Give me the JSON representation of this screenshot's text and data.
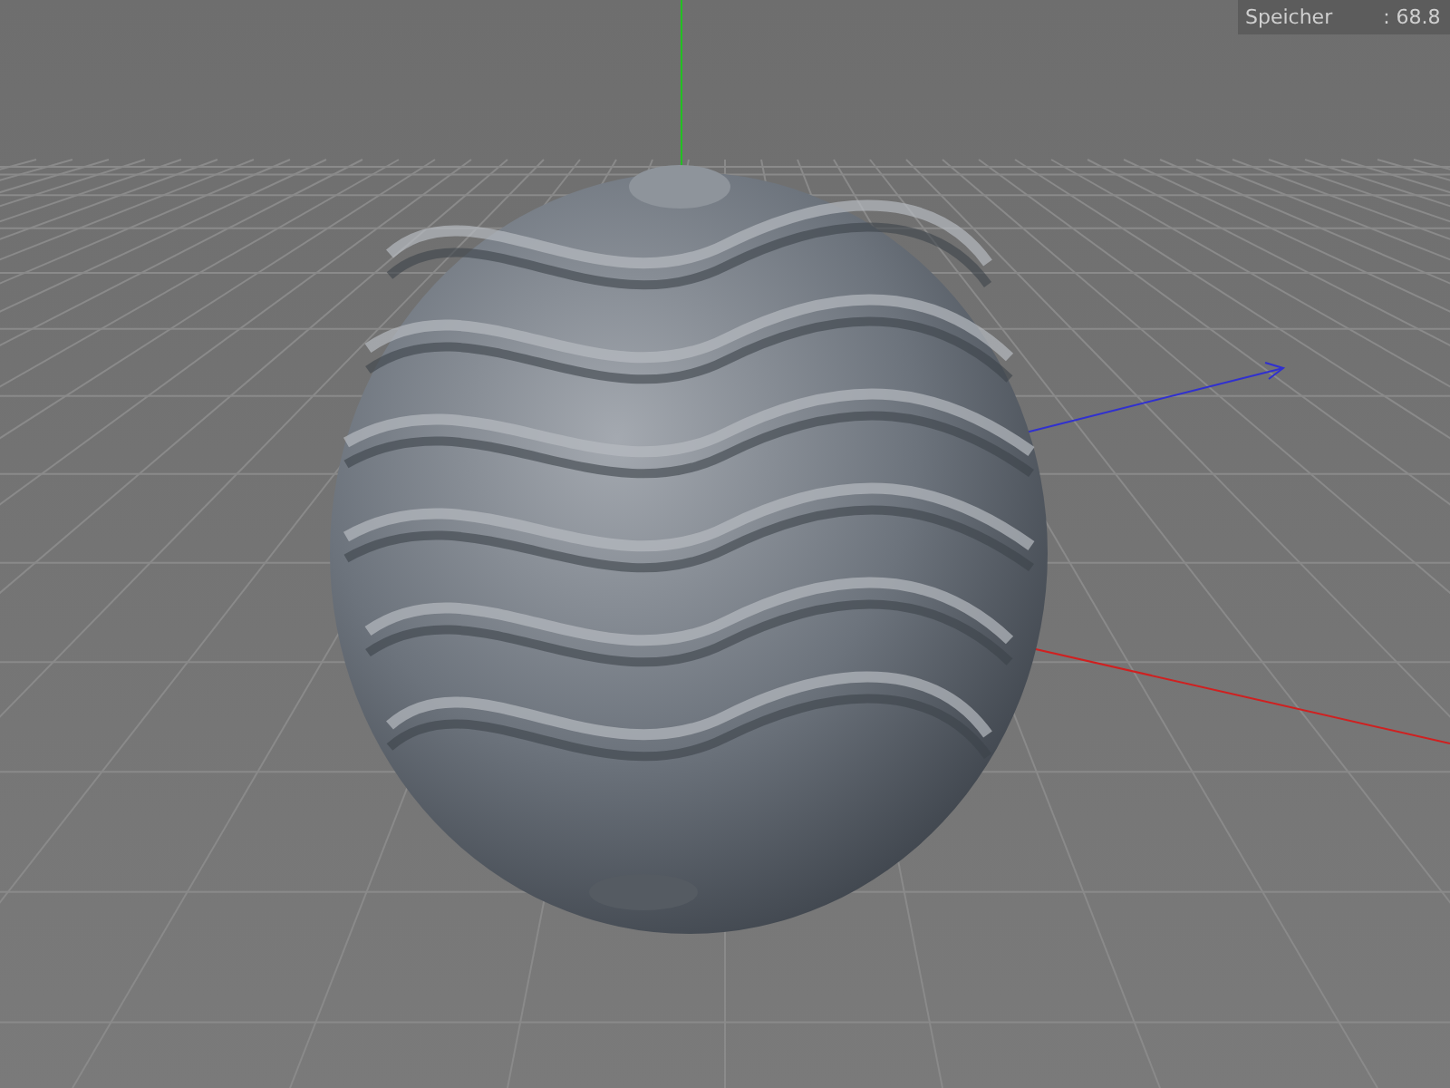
{
  "hud": {
    "label": "Speicher",
    "value": ": 68.8"
  }
}
